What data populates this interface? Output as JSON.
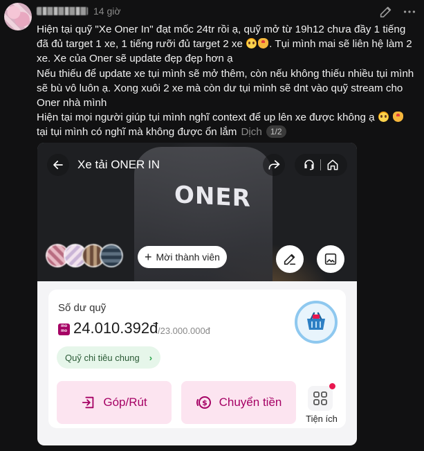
{
  "post": {
    "author_name": "",
    "time": "14 giờ",
    "lines": [
      "Hiện tại quỹ \"Xe Oner In\" đạt mốc 24tr rồi ạ, quỹ mở từ 19h12 chưa đầy 1 tiếng",
      "đã đủ target 1 xe, 1 tiếng rưỡi đủ target 2 xe",
      ". Tụi mình mai sẽ liên hệ làm 2",
      "xe. Xe của Oner sẽ update đẹp đẹp hơn ạ",
      "Nếu thiếu để update xe tụi mình sẽ mở thêm, còn nếu không thiếu nhiều tụi mình",
      "sẽ bù vô luôn ạ. Xong xuôi 2 xe mà còn dư tụi mình sẽ dnt vào quỹ stream cho",
      "Oner nhà mình",
      "Hiện tại mọi người giúp tụi mình nghĩ context để up lên xe được không ạ",
      "tại tụi mình có nghĩ mà không được ổn lắm"
    ],
    "translate_label": "Dịch",
    "page_indicator": "1/2"
  },
  "fund": {
    "title": "Xe tải ONER IN",
    "shirt_text": "ONER",
    "invite_label": "Mời thành viên",
    "balance_label": "Số dư quỹ",
    "momo_text": "mo mo",
    "balance": "24.010.392đ",
    "target": "/23.000.000đ",
    "category_chip": "Quỹ chi tiêu chung",
    "deposit_label": "Góp/Rút",
    "transfer_label": "Chuyển tiền",
    "utility_label": "Tiện ích"
  },
  "colors": {
    "background": "#111112",
    "brand": "#a50064",
    "brand_soft": "#fce4f0",
    "chip_bg": "#e6f6ea",
    "notification": "#e8174f"
  },
  "icons": [
    "edit-icon",
    "more-icon",
    "back-icon",
    "share-icon",
    "support-icon",
    "home-icon",
    "pencil-icon",
    "image-icon",
    "basket-icon",
    "deposit-icon",
    "transfer-icon",
    "grid-icon",
    "chevron-right-icon"
  ]
}
